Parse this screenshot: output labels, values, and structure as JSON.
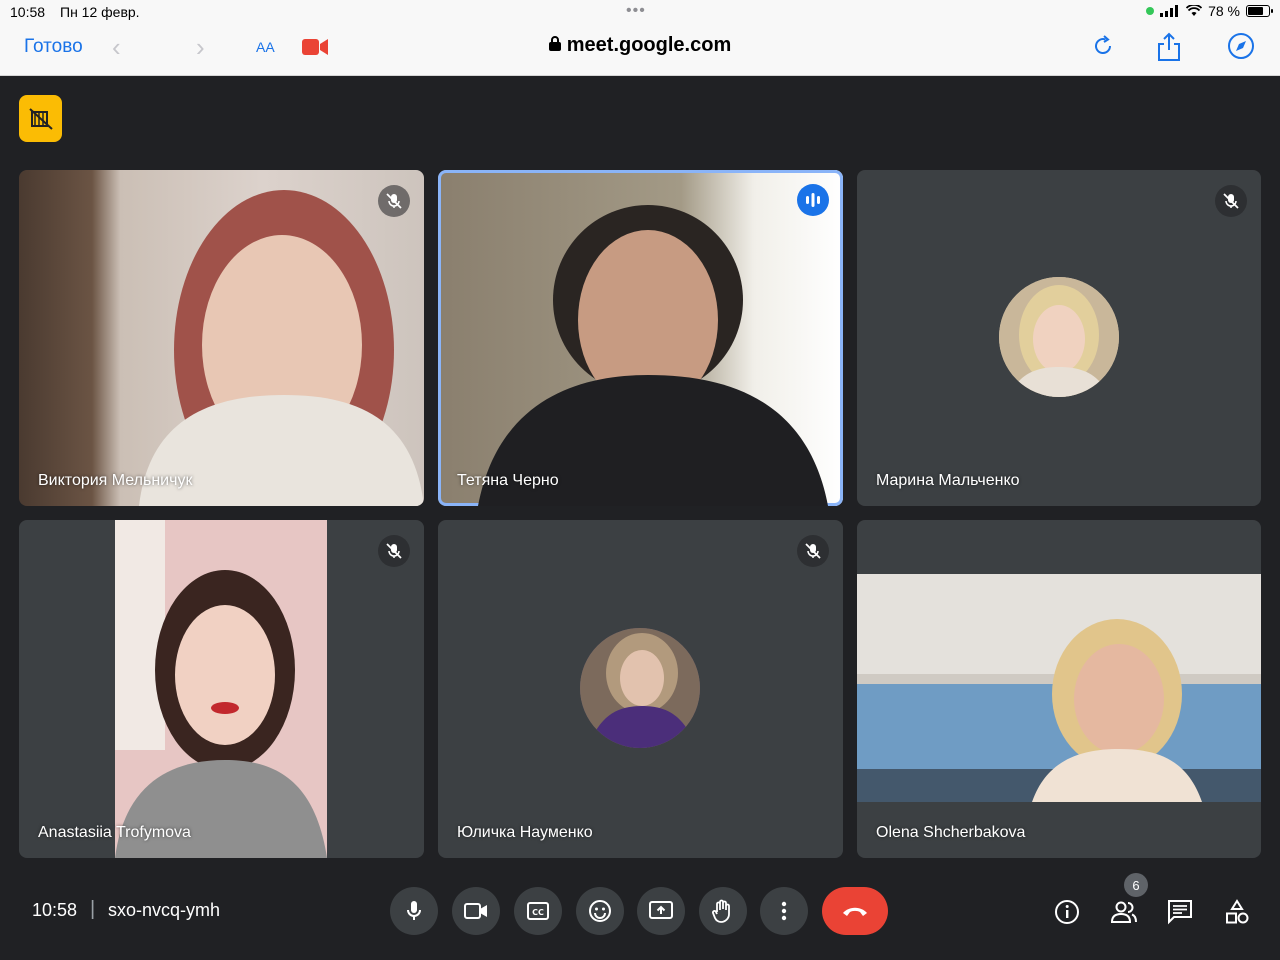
{
  "status_bar": {
    "time": "10:58",
    "date": "Пн 12 февр.",
    "battery": "78 %",
    "battery_level": 0.78
  },
  "browser": {
    "done_label": "Готово",
    "text_size_label": "AA",
    "url": "meet.google.com"
  },
  "participants": [
    {
      "name": "Виктория Мельничук",
      "muted": true,
      "speaking": false
    },
    {
      "name": "Тетяна Черно",
      "muted": false,
      "speaking": true
    },
    {
      "name": "Марина Мальченко",
      "muted": true,
      "speaking": false
    },
    {
      "name": "Anastasiia Trofymova",
      "muted": true,
      "speaking": false
    },
    {
      "name": "Юличка Науменко",
      "muted": true,
      "speaking": false
    },
    {
      "name": "Olena Shcherbakova",
      "muted": false,
      "speaking": false
    }
  ],
  "meeting": {
    "time": "10:58",
    "code": "sxo-nvcq-ymh",
    "people_count": "6"
  },
  "colors": {
    "background": "#202124",
    "tile": "#3c4043",
    "accent": "#1a73e8",
    "end_call": "#ea4335",
    "hint_badge": "#fbbc04"
  },
  "icons": {
    "hint_badge": "camera-off-icon",
    "controls": [
      "microphone-icon",
      "camera-icon",
      "captions-icon",
      "emoji-icon",
      "present-screen-icon",
      "raise-hand-icon",
      "more-options-icon",
      "end-call-icon"
    ],
    "right_controls": [
      "info-icon",
      "people-icon",
      "chat-icon",
      "activities-icon"
    ]
  }
}
